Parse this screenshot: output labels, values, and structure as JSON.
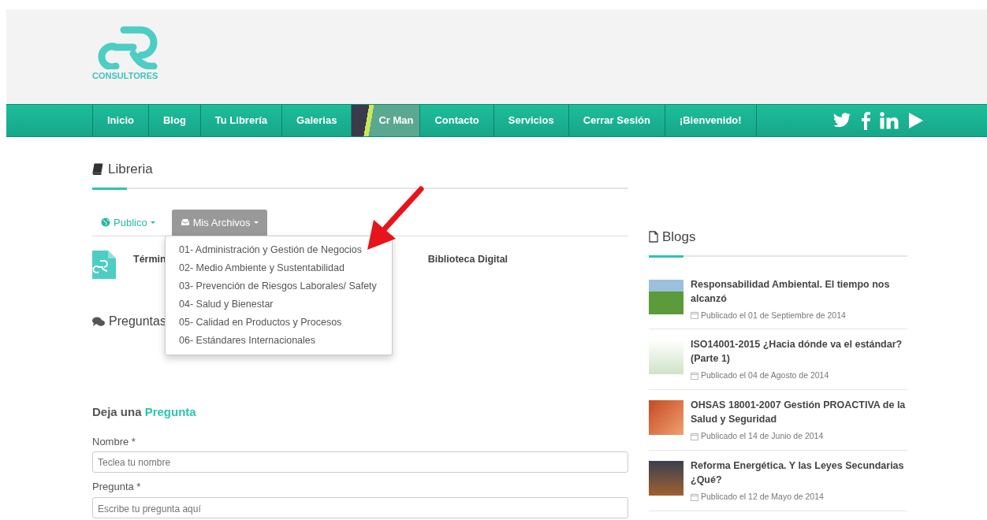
{
  "logo": {
    "text": "CONSULTORES"
  },
  "nav": {
    "items": [
      {
        "label": "Inicio",
        "kind": "link"
      },
      {
        "label": "Blog",
        "kind": "link"
      },
      {
        "label": "Tu Librería",
        "kind": "link"
      },
      {
        "label": "Galerias",
        "kind": "link"
      },
      {
        "label": "Cr Man",
        "kind": "image"
      },
      {
        "label": "Contacto",
        "kind": "link"
      },
      {
        "label": "Servicios",
        "kind": "link"
      },
      {
        "label": "Cerrar Sesión",
        "kind": "link"
      },
      {
        "label": "¡Bienvenido!",
        "kind": "link"
      }
    ]
  },
  "library": {
    "title": "Libreria",
    "tabs": [
      {
        "label": "Publico",
        "selected": false
      },
      {
        "label": "Mis Archivos",
        "selected": true,
        "menu": [
          "01- Administración y Gestión de Negocios",
          "02- Medio Ambiente y Sustentabilidad",
          "03- Prevención de Riesgos Laborales/ Safety",
          "04- Salud y Bienestar",
          "05- Calidad en Productos y Procesos",
          "06- Estándares Internacionales"
        ]
      }
    ],
    "document": {
      "text_start": "Términ",
      "text_end": "Biblioteca Digital"
    },
    "questions_title": "Preguntas"
  },
  "form": {
    "title": "Deja una",
    "title_accent": "Pregunta",
    "fields": [
      {
        "label": "Nombre *",
        "placeholder": "Teclea tu nombre",
        "kind": "input"
      },
      {
        "label": "Pregunta *",
        "placeholder": "Escribe tu pregunta aquí",
        "kind": "textarea"
      }
    ]
  },
  "sidebar": {
    "title": "Blogs",
    "posts": [
      {
        "title": "Responsabilidad Ambiental. El tiempo nos alcanzó",
        "date": "Publicado el 01 de Septiembre de 2014"
      },
      {
        "title": "ISO14001-2015 ¿Hacia dónde va el estándar? (Parte 1)",
        "date": "Publicado el 04 de Agosto de 2014"
      },
      {
        "title": "OHSAS 18001-2007 Gestión PROACTIVA de la Salud y Seguridad",
        "date": "Publicado el 14 de Junio de 2014"
      },
      {
        "title": "Reforma Energética. Y las Leyes Secundarias ¿Qué?",
        "date": "Publicado el 12 de Mayo de 2014"
      }
    ]
  }
}
